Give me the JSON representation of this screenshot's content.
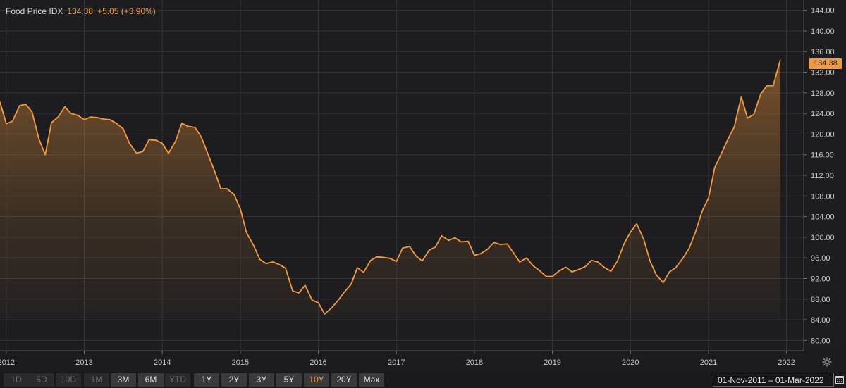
{
  "legend": {
    "name": "Food Price IDX",
    "last": "134.38",
    "change": "+5.05 (+3.90%)"
  },
  "price_tag": "134.38",
  "colors": {
    "line": "#f39b3b",
    "grid": "#333338",
    "axis_text": "#c8c8c8",
    "background": "#1d1d20"
  },
  "toolbar": {
    "buttons": [
      {
        "label": "1D",
        "state": "disabled"
      },
      {
        "label": "5D",
        "state": "disabled"
      },
      {
        "label": "10D",
        "state": "disabled"
      },
      {
        "label": "1M",
        "state": "disabled"
      },
      {
        "label": "3M",
        "state": "normal"
      },
      {
        "label": "6M",
        "state": "normal"
      },
      {
        "label": "YTD",
        "state": "disabled"
      },
      {
        "label": "1Y",
        "state": "normal"
      },
      {
        "label": "2Y",
        "state": "normal"
      },
      {
        "label": "3Y",
        "state": "normal"
      },
      {
        "label": "5Y",
        "state": "normal"
      },
      {
        "label": "10Y",
        "state": "active"
      },
      {
        "label": "20Y",
        "state": "normal"
      },
      {
        "label": "Max",
        "state": "normal"
      }
    ],
    "date_range": "01-Nov-2011 – 01-Mar-2022",
    "icons": {
      "calendar": "calendar-icon",
      "settings": "gear-icon"
    }
  },
  "chart_data": {
    "type": "area",
    "title": "",
    "xlabel": "",
    "ylabel": "",
    "ylim": [
      78.0,
      146.0
    ],
    "yticks": [
      80.0,
      84.0,
      88.0,
      92.0,
      96.0,
      100.0,
      104.0,
      108.0,
      112.0,
      116.0,
      120.0,
      124.0,
      128.0,
      132.0,
      136.0,
      140.0,
      144.0
    ],
    "ytick_labels": [
      "80.00",
      "84.00",
      "88.00",
      "92.00",
      "96.00",
      "100.00",
      "104.00",
      "108.00",
      "112.00",
      "116.00",
      "120.00",
      "124.00",
      "128.00",
      "132.00",
      "136.00",
      "140.00",
      "144.00"
    ],
    "xlim": [
      2011.92,
      2022.22
    ],
    "xticks": [
      2012,
      2013,
      2014,
      2015,
      2016,
      2017,
      2018,
      2019,
      2020,
      2021,
      2022
    ],
    "xtick_labels": [
      "2012",
      "2013",
      "2014",
      "2015",
      "2016",
      "2017",
      "2018",
      "2019",
      "2020",
      "2021",
      "2022"
    ],
    "grid": true,
    "series": [
      {
        "values": [
          [
            2011.92,
            126.2
          ],
          [
            2012.0,
            122.0
          ],
          [
            2012.08,
            122.5
          ],
          [
            2012.17,
            125.5
          ],
          [
            2012.25,
            125.8
          ],
          [
            2012.33,
            124.3
          ],
          [
            2012.42,
            119.0
          ],
          [
            2012.5,
            116.0
          ],
          [
            2012.58,
            122.2
          ],
          [
            2012.67,
            123.4
          ],
          [
            2012.75,
            125.3
          ],
          [
            2012.83,
            124.0
          ],
          [
            2012.92,
            123.6
          ],
          [
            2013.0,
            122.8
          ],
          [
            2013.08,
            123.3
          ],
          [
            2013.17,
            123.2
          ],
          [
            2013.25,
            122.9
          ],
          [
            2013.33,
            122.8
          ],
          [
            2013.42,
            122.0
          ],
          [
            2013.5,
            121.0
          ],
          [
            2013.58,
            118.2
          ],
          [
            2013.67,
            116.3
          ],
          [
            2013.75,
            116.6
          ],
          [
            2013.83,
            118.9
          ],
          [
            2013.92,
            118.8
          ],
          [
            2014.0,
            118.2
          ],
          [
            2014.08,
            116.3
          ],
          [
            2014.17,
            118.6
          ],
          [
            2014.25,
            122.1
          ],
          [
            2014.33,
            121.5
          ],
          [
            2014.42,
            121.3
          ],
          [
            2014.5,
            119.4
          ],
          [
            2014.58,
            116.3
          ],
          [
            2014.67,
            112.8
          ],
          [
            2014.75,
            109.4
          ],
          [
            2014.83,
            109.4
          ],
          [
            2014.92,
            108.3
          ],
          [
            2015.0,
            105.5
          ],
          [
            2015.08,
            100.9
          ],
          [
            2015.17,
            98.4
          ],
          [
            2015.25,
            95.7
          ],
          [
            2015.33,
            94.9
          ],
          [
            2015.42,
            95.2
          ],
          [
            2015.5,
            94.7
          ],
          [
            2015.58,
            94.0
          ],
          [
            2015.67,
            89.6
          ],
          [
            2015.75,
            89.2
          ],
          [
            2015.83,
            90.7
          ],
          [
            2015.92,
            87.8
          ],
          [
            2016.0,
            87.3
          ],
          [
            2016.08,
            85.1
          ],
          [
            2016.17,
            86.3
          ],
          [
            2016.25,
            87.7
          ],
          [
            2016.33,
            89.3
          ],
          [
            2016.42,
            90.9
          ],
          [
            2016.5,
            94.1
          ],
          [
            2016.58,
            93.2
          ],
          [
            2016.67,
            95.5
          ],
          [
            2016.75,
            96.2
          ],
          [
            2016.83,
            96.1
          ],
          [
            2016.92,
            95.9
          ],
          [
            2017.0,
            95.3
          ],
          [
            2017.08,
            97.9
          ],
          [
            2017.17,
            98.2
          ],
          [
            2017.25,
            96.4
          ],
          [
            2017.33,
            95.4
          ],
          [
            2017.42,
            97.5
          ],
          [
            2017.5,
            98.1
          ],
          [
            2017.58,
            100.3
          ],
          [
            2017.67,
            99.4
          ],
          [
            2017.75,
            99.9
          ],
          [
            2017.83,
            99.1
          ],
          [
            2017.92,
            99.2
          ],
          [
            2018.0,
            96.5
          ],
          [
            2018.08,
            96.8
          ],
          [
            2018.17,
            97.7
          ],
          [
            2018.25,
            99.0
          ],
          [
            2018.33,
            98.6
          ],
          [
            2018.42,
            98.7
          ],
          [
            2018.5,
            97.0
          ],
          [
            2018.58,
            95.2
          ],
          [
            2018.67,
            96.0
          ],
          [
            2018.75,
            94.5
          ],
          [
            2018.83,
            93.6
          ],
          [
            2018.92,
            92.4
          ],
          [
            2019.0,
            92.4
          ],
          [
            2019.08,
            93.4
          ],
          [
            2019.17,
            94.2
          ],
          [
            2019.25,
            93.3
          ],
          [
            2019.33,
            93.7
          ],
          [
            2019.42,
            94.3
          ],
          [
            2019.5,
            95.5
          ],
          [
            2019.58,
            95.2
          ],
          [
            2019.67,
            94.1
          ],
          [
            2019.75,
            93.4
          ],
          [
            2019.83,
            95.3
          ],
          [
            2019.92,
            98.8
          ],
          [
            2020.0,
            101.0
          ],
          [
            2020.08,
            102.6
          ],
          [
            2020.17,
            99.6
          ],
          [
            2020.25,
            95.4
          ],
          [
            2020.33,
            92.7
          ],
          [
            2020.42,
            91.2
          ],
          [
            2020.5,
            93.3
          ],
          [
            2020.58,
            94.1
          ],
          [
            2020.67,
            95.9
          ],
          [
            2020.75,
            97.8
          ],
          [
            2020.83,
            100.9
          ],
          [
            2020.92,
            105.1
          ],
          [
            2021.0,
            107.6
          ],
          [
            2021.08,
            113.5
          ],
          [
            2021.17,
            116.4
          ],
          [
            2021.25,
            119.0
          ],
          [
            2021.33,
            121.4
          ],
          [
            2021.42,
            127.2
          ],
          [
            2021.5,
            123.1
          ],
          [
            2021.58,
            123.8
          ],
          [
            2021.67,
            127.8
          ],
          [
            2021.75,
            129.4
          ],
          [
            2021.83,
            129.4
          ],
          [
            2021.92,
            134.38
          ]
        ]
      }
    ]
  }
}
